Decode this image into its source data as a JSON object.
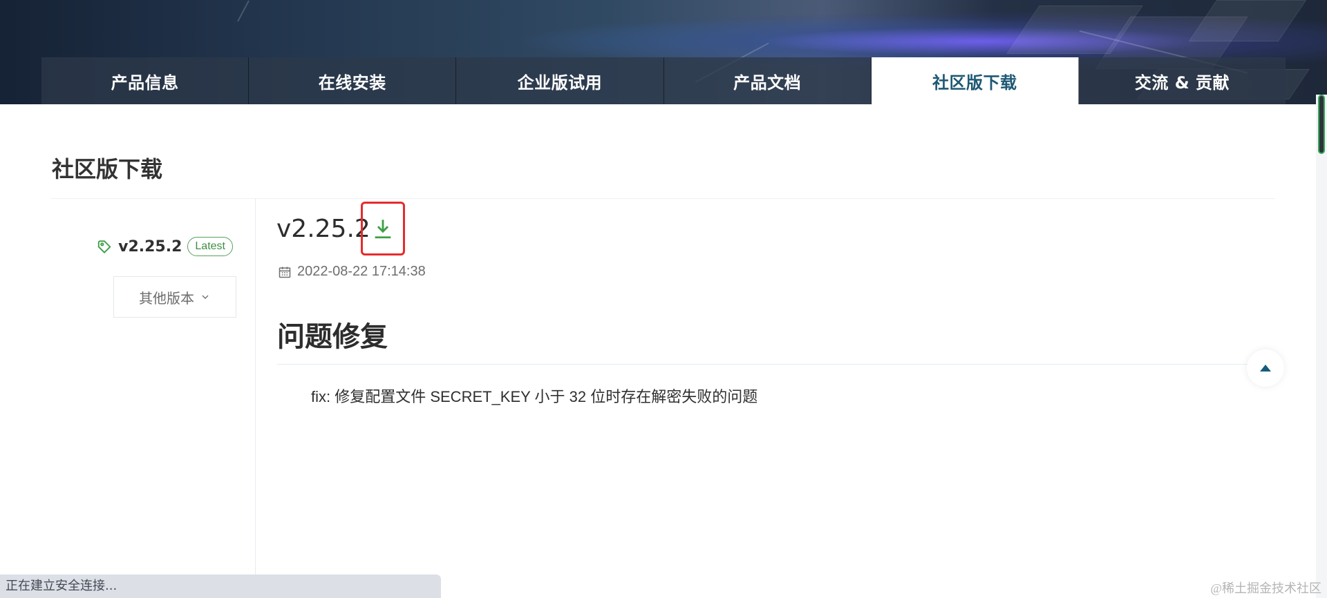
{
  "nav": {
    "tabs": [
      {
        "label": "产品信息"
      },
      {
        "label": "在线安装"
      },
      {
        "label": "企业版试用"
      },
      {
        "label": "产品文档"
      },
      {
        "label": "社区版下载",
        "active": true
      },
      {
        "label": "交流 & 贡献"
      }
    ]
  },
  "page": {
    "title": "社区版下载"
  },
  "release_panel": {
    "version_tag": "v2.25.2",
    "latest_badge": "Latest",
    "other_versions_button": "其他版本"
  },
  "release": {
    "version": "v2.25.2",
    "date": "2022-08-22 17:14:38",
    "section_title": "问题修复",
    "fix_text": "fix: 修复配置文件 SECRET_KEY 小于 32 位时存在解密失败的问题"
  },
  "browser": {
    "status_text": "正在建立安全连接..."
  },
  "watermark": "@稀土掘金技术社区",
  "icons": {
    "tag": "tag-icon",
    "download": "download-icon",
    "calendar": "calendar-icon",
    "chevron": "chevron-down-icon",
    "back_to_top": "arrow-up-icon"
  },
  "colors": {
    "active_tab_text": "#1e5874",
    "download_icon": "#3b9f45",
    "latest_badge": "#3f8e46",
    "highlight_border": "#e52b2b"
  }
}
